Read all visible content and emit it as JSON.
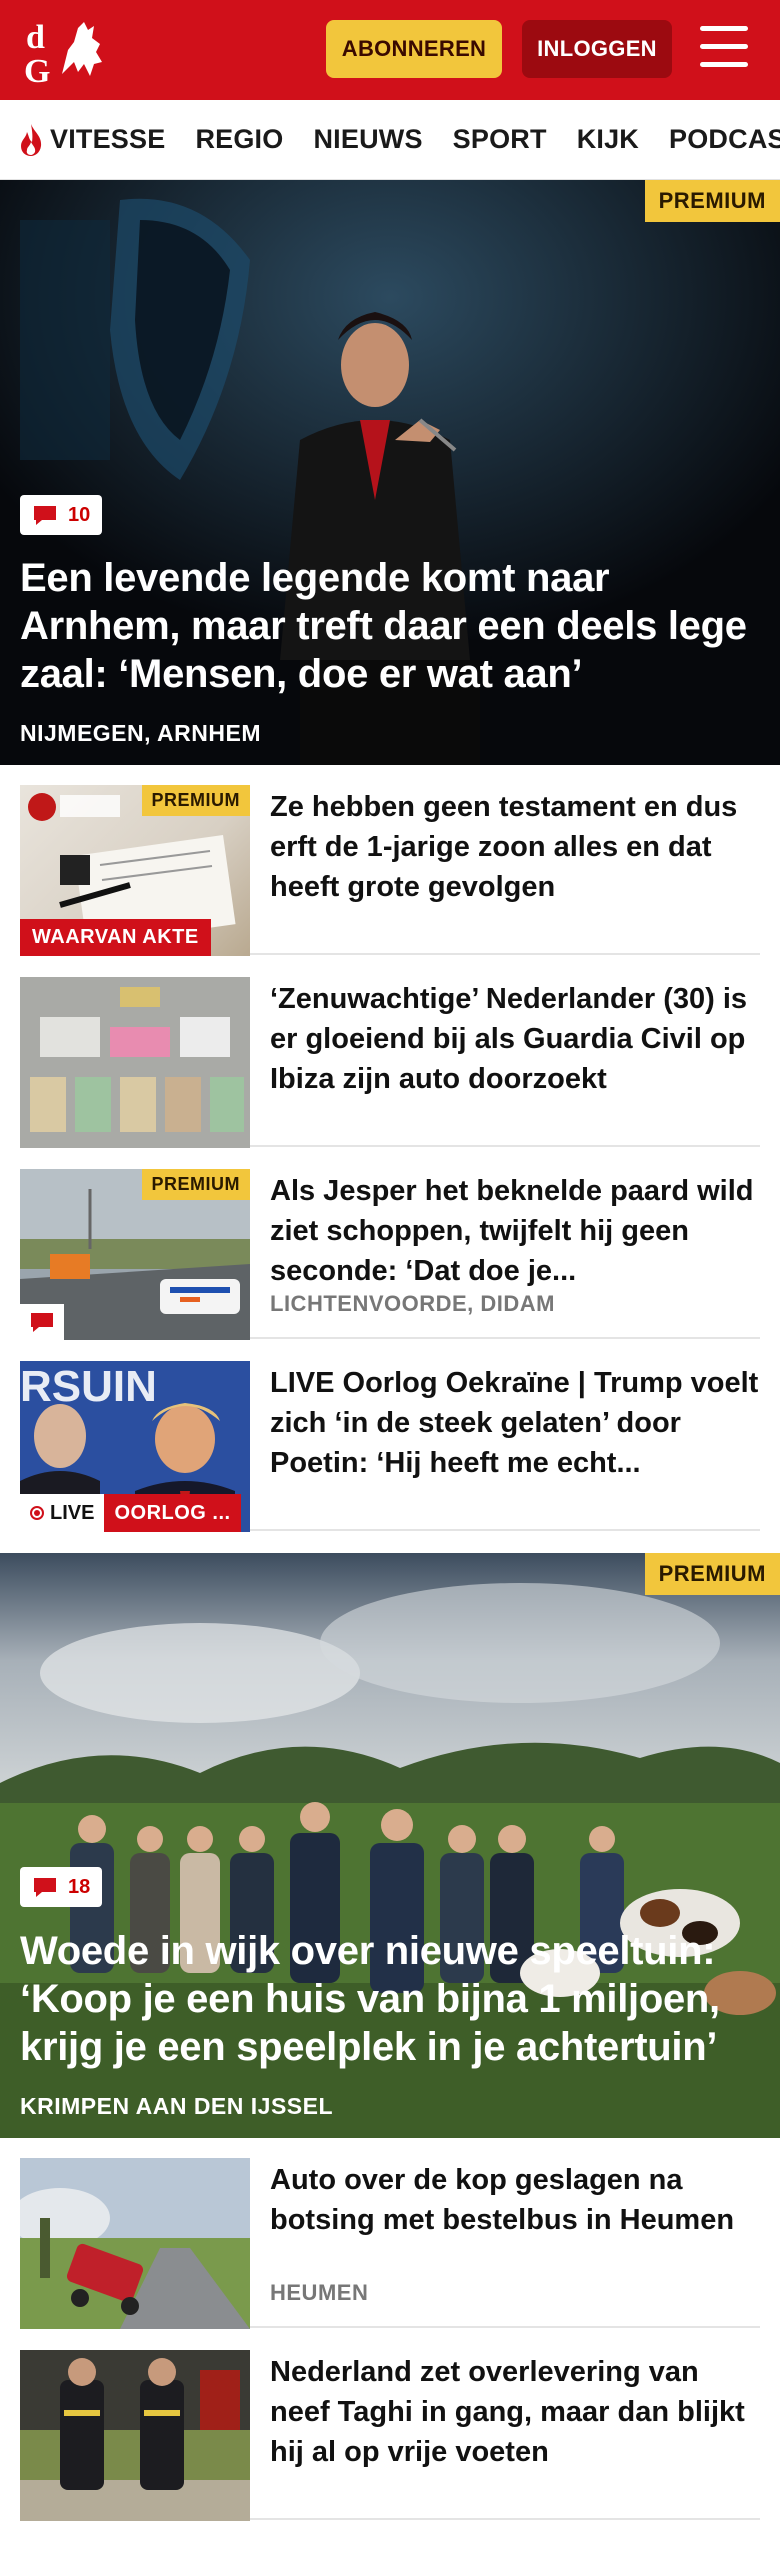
{
  "header": {
    "subscribe_label": "ABONNEREN",
    "login_label": "INLOGGEN",
    "logo_text": "dG",
    "brand_color": "#d0101a"
  },
  "nav": {
    "items": [
      {
        "label": "VITESSE",
        "icon": "flame-icon"
      },
      {
        "label": "REGIO"
      },
      {
        "label": "NIEUWS"
      },
      {
        "label": "SPORT"
      },
      {
        "label": "KIJK"
      },
      {
        "label": "PODCAST"
      }
    ]
  },
  "hero1": {
    "premium": "PREMIUM",
    "comments": "10",
    "title": "Een levende legende komt naar Arnhem, maar treft daar een deels lege zaal: ‘Mensen, doe er wat aan’",
    "location": "NIJMEGEN, ARNHEM"
  },
  "articles": [
    {
      "title": "Ze hebben geen testament en dus erft de 1-jarige zoon alles en dat heeft grote gevolgen",
      "premium": "PREMIUM",
      "label": "WAARVAN AKTE"
    },
    {
      "title": "‘Zenuwachtige’ Nederlander (30) is er gloeiend bij als Guardia Civil op Ibiza zijn auto doorzoekt"
    },
    {
      "title": "Als Jesper het beknelde paard wild ziet schoppen, twijfelt hij geen seconde: ‘Dat doe je...",
      "premium": "PREMIUM",
      "location": "LICHTENVOORDE, DIDAM"
    },
    {
      "title": "LIVE Oorlog Oekraïne | Trump voelt zich ‘in de steek gelaten’ door Poetin: ‘Hij heeft me echt...",
      "live": "LIVE",
      "label": "OORLOG ..."
    }
  ],
  "hero2": {
    "premium": "PREMIUM",
    "comments": "18",
    "title": "Woede in wijk over nieuwe speeltuin: ‘Koop je een huis van bijna 1 miljoen, krijg je een speelplek in je achtertuin’",
    "location": "KRIMPEN AAN DEN IJSSEL"
  },
  "articles2": [
    {
      "title": "Auto over de kop geslagen na botsing met bestelbus in Heumen",
      "location": "HEUMEN"
    },
    {
      "title": "Nederland zet overlevering van neef Taghi in gang, maar dan blijkt hij al op vrije voeten"
    }
  ]
}
